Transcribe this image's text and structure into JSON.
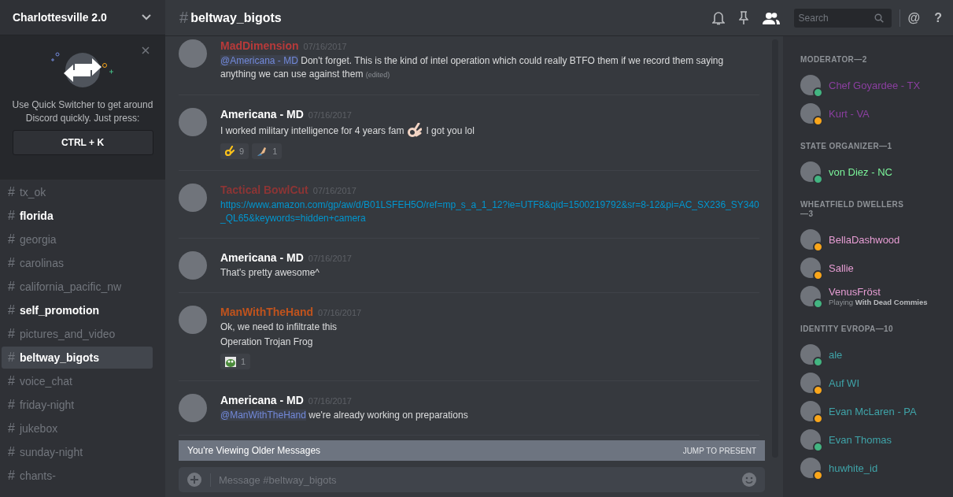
{
  "server": {
    "name": "Charlottesville 2.0"
  },
  "quick_switcher": {
    "text": "Use Quick Switcher to get around Discord quickly. Just press:",
    "shortcut": "CTRL + K"
  },
  "channels": [
    {
      "hash": "#",
      "name": "tx_ok",
      "unread": false,
      "selected": false
    },
    {
      "hash": "#",
      "name": "florida",
      "unread": true,
      "selected": false
    },
    {
      "hash": "#",
      "name": "georgia",
      "unread": false,
      "selected": false
    },
    {
      "hash": "#",
      "name": "carolinas",
      "unread": false,
      "selected": false
    },
    {
      "hash": "#",
      "name": "california_pacific_nw",
      "unread": false,
      "selected": false
    },
    {
      "hash": "#",
      "name": "self_promotion",
      "unread": true,
      "selected": false
    },
    {
      "hash": "#",
      "name": "pictures_and_video",
      "unread": false,
      "selected": false
    },
    {
      "hash": "#",
      "name": "beltway_bigots",
      "unread": false,
      "selected": true
    },
    {
      "hash": "#",
      "name": "voice_chat",
      "unread": false,
      "selected": false
    },
    {
      "hash": "#",
      "name": "friday-night",
      "unread": false,
      "selected": false
    },
    {
      "hash": "#",
      "name": "jukebox",
      "unread": false,
      "selected": false
    },
    {
      "hash": "#",
      "name": "sunday-night",
      "unread": false,
      "selected": false
    },
    {
      "hash": "#",
      "name": "chants-",
      "unread": false,
      "selected": false
    }
  ],
  "header": {
    "hash": "#",
    "channel": "beltway_bigots",
    "search_placeholder": "Search",
    "mention_symbol": "@",
    "help_symbol": "?"
  },
  "messages": [
    {
      "author": "MadDimension",
      "color": "#b83a3a",
      "timestamp": "07/16/2017",
      "lines": [
        [
          {
            "kind": "mention",
            "text": "@Americana - MD"
          },
          {
            "kind": "text",
            "text": " Don't forget. This is the kind of intel operation which could really BTFO them if we record them saying anything we can use against them "
          },
          {
            "kind": "edited",
            "text": "(edited)"
          }
        ]
      ]
    },
    {
      "author": "Americana - MD",
      "color": "#ffffff",
      "timestamp": "07/16/2017",
      "lines": [
        [
          {
            "kind": "text",
            "text": "I worked military intelligence for 4 years fam"
          },
          {
            "kind": "emoji"
          },
          {
            "kind": "text",
            "text": "I got you lol"
          }
        ]
      ],
      "reactions": [
        {
          "kind": "ok-hand",
          "count": "9"
        },
        {
          "kind": "pinch-hand",
          "count": "1"
        }
      ]
    },
    {
      "author": "Tactical BowlCut",
      "color": "#8c3535",
      "timestamp": "07/16/2017",
      "lines": [
        [
          {
            "kind": "link",
            "text": "https://www.amazon.com/gp/aw/d/B01LSFEH5O/ref=mp_s_a_1_12?ie=UTF8&qid=1500219792&sr=8-12&pi=AC_SX236_SY340_QL65&keywords=hidden+camera"
          }
        ]
      ]
    },
    {
      "author": "Americana - MD",
      "color": "#ffffff",
      "timestamp": "07/16/2017",
      "lines": [
        [
          {
            "kind": "text",
            "text": "That's pretty awesome^"
          }
        ]
      ]
    },
    {
      "author": "ManWithTheHand",
      "color": "#c0531d",
      "timestamp": "07/16/2017",
      "lines": [
        [
          {
            "kind": "text",
            "text": "Ok, we need to infiltrate this"
          }
        ],
        [
          {
            "kind": "text",
            "text": "Operation Trojan Frog"
          }
        ]
      ],
      "reactions": [
        {
          "kind": "frog",
          "count": "1"
        }
      ]
    },
    {
      "author": "Americana - MD",
      "color": "#ffffff",
      "timestamp": "07/16/2017",
      "lines": [
        [
          {
            "kind": "mention",
            "text": "@ManWithTheHand"
          },
          {
            "kind": "text",
            "text": " we're already working on preparations"
          }
        ]
      ]
    }
  ],
  "older_banner": {
    "text": "You're Viewing Older Messages",
    "action": "JUMP TO PRESENT"
  },
  "composer": {
    "placeholder": "Message #beltway_bigots"
  },
  "member_groups": [
    {
      "title": "MODERATOR—2",
      "members": [
        {
          "name": "Chef Goyardee - TX",
          "color": "#8b3fa0",
          "idle": false
        },
        {
          "name": "Kurt - VA",
          "color": "#8b3fa0",
          "idle": true
        }
      ]
    },
    {
      "title": "STATE ORGANIZER—1",
      "members": [
        {
          "name": "von Diez - NC",
          "color": "#7bf49a",
          "idle": false
        }
      ]
    },
    {
      "title": "WHEATFIELD DWELLERS—3",
      "members": [
        {
          "name": "BellaDashwood",
          "color": "#e79dd4",
          "idle": true
        },
        {
          "name": "Sallie",
          "color": "#e79dd4",
          "idle": true
        },
        {
          "name": "VenusFröst",
          "color": "#e79dd4",
          "idle": false,
          "activity": "Playing **With Dead Commies**"
        }
      ]
    },
    {
      "title": "IDENTITY EVROPA—10",
      "members": [
        {
          "name": "ale",
          "color": "#3fa3a8",
          "idle": false
        },
        {
          "name": "Auf WI",
          "color": "#3fa3a8",
          "idle": true
        },
        {
          "name": "Evan McLaren - PA",
          "color": "#3fa3a8",
          "idle": true
        },
        {
          "name": "Evan Thomas",
          "color": "#3fa3a8",
          "idle": false
        },
        {
          "name": "huwhite_id",
          "color": "#3fa3a8",
          "idle": true
        }
      ]
    }
  ]
}
